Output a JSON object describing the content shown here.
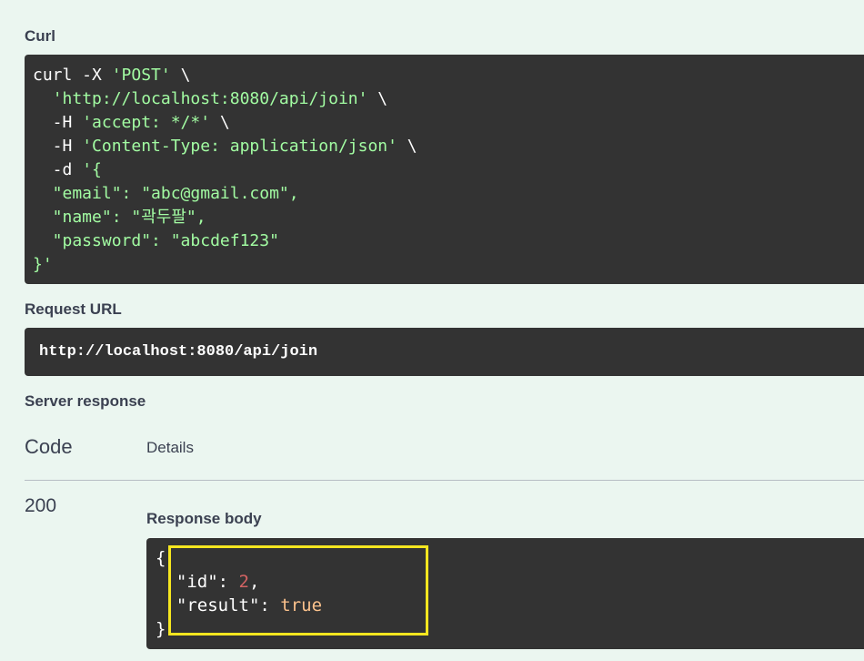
{
  "curl_section": {
    "label": "Curl",
    "lines": [
      {
        "plain": "curl -X ",
        "str": "'POST'",
        "tail": " \\"
      },
      {
        "plain": "  ",
        "str": "'http://localhost:8080/api/join'",
        "tail": " \\"
      },
      {
        "plain": "  -H ",
        "str": "'accept: */*'",
        "tail": " \\"
      },
      {
        "plain": "  -H ",
        "str": "'Content-Type: application/json'",
        "tail": " \\"
      },
      {
        "plain": "  -d ",
        "str": "'{",
        "tail": ""
      },
      {
        "plain": "",
        "str": "  \"email\": \"abc@gmail.com\",",
        "tail": ""
      },
      {
        "plain": "",
        "str": "  \"name\": \"곽두팔\",",
        "tail": ""
      },
      {
        "plain": "",
        "str": "  \"password\": \"abcdef123\"",
        "tail": ""
      },
      {
        "plain": "",
        "str": "}'",
        "tail": ""
      }
    ]
  },
  "request_url_section": {
    "label": "Request URL",
    "url": "http://localhost:8080/api/join"
  },
  "server_response": {
    "label": "Server response",
    "col_code": "Code",
    "col_details": "Details",
    "status_code": "200",
    "response_body_label": "Response body",
    "body": {
      "open_brace": "{",
      "id_key": "\"id\"",
      "id_value": "2",
      "result_key": "\"result\"",
      "result_value": "true",
      "close_brace": "}"
    }
  },
  "colors": {
    "background": "#ebf6f0",
    "code_bg": "#333333",
    "string": "#a2fca2",
    "number": "#d36363",
    "boolean": "#fcc28c",
    "highlight": "#f5e61f"
  }
}
